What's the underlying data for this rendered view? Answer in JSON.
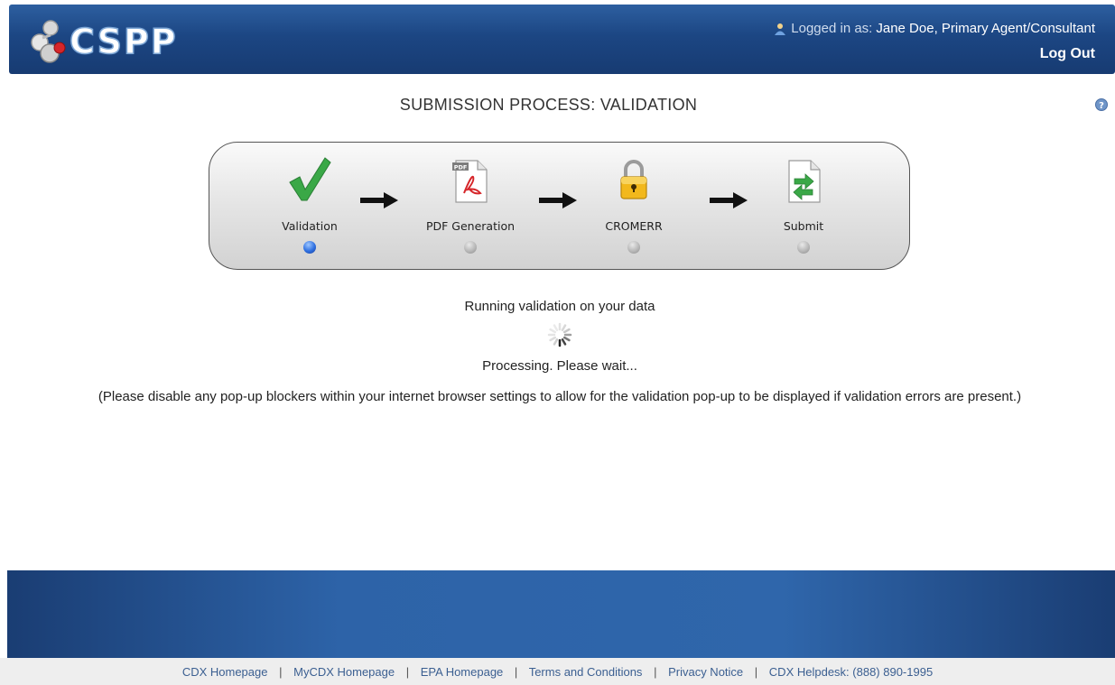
{
  "header": {
    "logo_text": "CSPP",
    "logged_in_prefix": "Logged in as:",
    "user_name": "Jane Doe, Primary Agent/Consultant",
    "logout_label": "Log Out"
  },
  "page": {
    "title": "SUBMISSION PROCESS: VALIDATION"
  },
  "steps": [
    {
      "label": "Validation",
      "icon": "checkmark-icon",
      "active": true
    },
    {
      "label": "PDF Generation",
      "icon": "pdf-document-icon",
      "active": false
    },
    {
      "label": "CROMERR",
      "icon": "padlock-icon",
      "active": false
    },
    {
      "label": "Submit",
      "icon": "submit-document-icon",
      "active": false
    }
  ],
  "status": {
    "running": "Running validation on your data",
    "processing": "Processing. Please wait...",
    "note": "(Please disable any pop-up blockers within your internet browser settings to allow for the validation pop-up to be displayed if validation errors are present.)"
  },
  "footer": {
    "links": [
      "CDX Homepage",
      "MyCDX Homepage",
      "EPA Homepage",
      "Terms and Conditions",
      "Privacy Notice",
      "CDX Helpdesk: (888) 890-1995"
    ],
    "separator": "|"
  },
  "colors": {
    "header_blue": "#1c4683",
    "active_step_dot": "#2e6fe0",
    "check_green": "#3aa847",
    "footer_link": "#3b5f91"
  }
}
